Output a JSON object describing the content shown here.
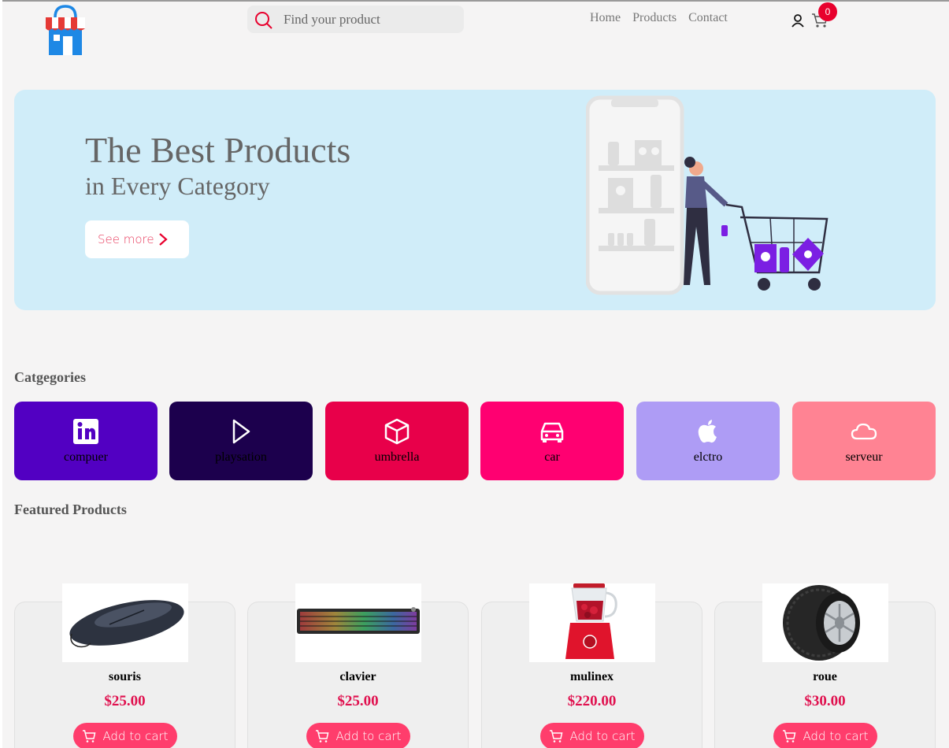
{
  "header": {
    "search_placeholder": "Find your product",
    "nav": [
      "Home",
      "Products",
      "Contact"
    ],
    "cart_count": "0"
  },
  "hero": {
    "title": "The Best Products",
    "subtitle": "in Every Category",
    "button_label": "See more"
  },
  "categories_title": "Catgegories",
  "categories": [
    {
      "label": "compuer",
      "icon": "linkedin-icon",
      "color": "#5200c2"
    },
    {
      "label": "playsation",
      "icon": "play-icon",
      "color": "#1c004d"
    },
    {
      "label": "umbrella",
      "icon": "box-icon",
      "color": "#e8004a"
    },
    {
      "label": "car",
      "icon": "car-icon",
      "color": "#ff0071"
    },
    {
      "label": "elctro",
      "icon": "apple-icon",
      "color": "#ae9cf5"
    },
    {
      "label": "serveur",
      "icon": "cloud-icon",
      "color": "#ff8393"
    }
  ],
  "featured_title": "Featured Products",
  "products": [
    {
      "name": "souris",
      "price": "$25.00",
      "button": "Add to cart"
    },
    {
      "name": "clavier",
      "price": "$25.00",
      "button": "Add to cart"
    },
    {
      "name": "mulinex",
      "price": "$220.00",
      "button": "Add to cart"
    },
    {
      "name": "roue",
      "price": "$30.00",
      "button": "Add to cart"
    }
  ],
  "colors": {
    "accent": "#ff3d6c",
    "price": "#e0114f",
    "hero_bg": "#d0edf9"
  }
}
